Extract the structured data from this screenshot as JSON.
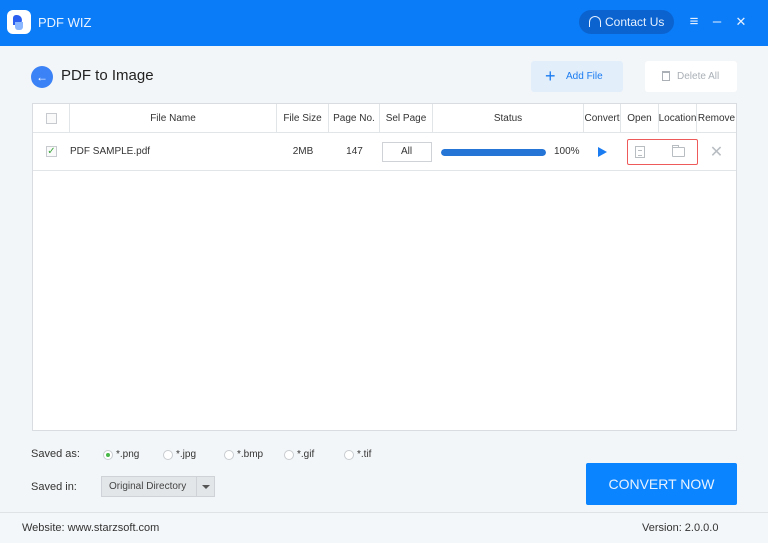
{
  "app": {
    "title": "PDF WIZ",
    "contact_label": "Contact Us",
    "menu_icon": "≡",
    "minimize_icon": "–",
    "close_icon": "✕"
  },
  "header": {
    "back_icon": "←",
    "page_title": "PDF to Image",
    "add_file_icon": "+",
    "add_file_label": "Add File",
    "delete_all_label": "Delete All"
  },
  "table": {
    "columns": [
      "",
      "File Name",
      "File Size",
      "Page No.",
      "Sel Page",
      "Status",
      "Convert",
      "Open",
      "Location",
      "Remove"
    ],
    "rows": [
      {
        "checked": true,
        "check_glyph": "✓",
        "file_name": "PDF SAMPLE.pdf",
        "file_size": "2MB",
        "page_no": "147",
        "sel_page": "All",
        "progress_percent": 100,
        "status_text": "100%",
        "remove_icon": "✕"
      }
    ]
  },
  "options": {
    "saved_as_label": "Saved as:",
    "formats": [
      {
        "label": "*.png",
        "selected": true
      },
      {
        "label": "*.jpg",
        "selected": false
      },
      {
        "label": "*.bmp",
        "selected": false
      },
      {
        "label": "*.gif",
        "selected": false
      },
      {
        "label": "*.tif",
        "selected": false
      }
    ],
    "saved_in_label": "Saved in:",
    "saved_in_value": "Original Directory",
    "convert_now_label": "CONVERT NOW"
  },
  "footer": {
    "website": "Website: www.starzsoft.com",
    "version": "Version:  2.0.0.0"
  },
  "colors": {
    "brand": "#0a7cf7",
    "accent": "#0a84ff",
    "highlight_border": "#ee5a5a",
    "selected_radio": "#48b848"
  }
}
